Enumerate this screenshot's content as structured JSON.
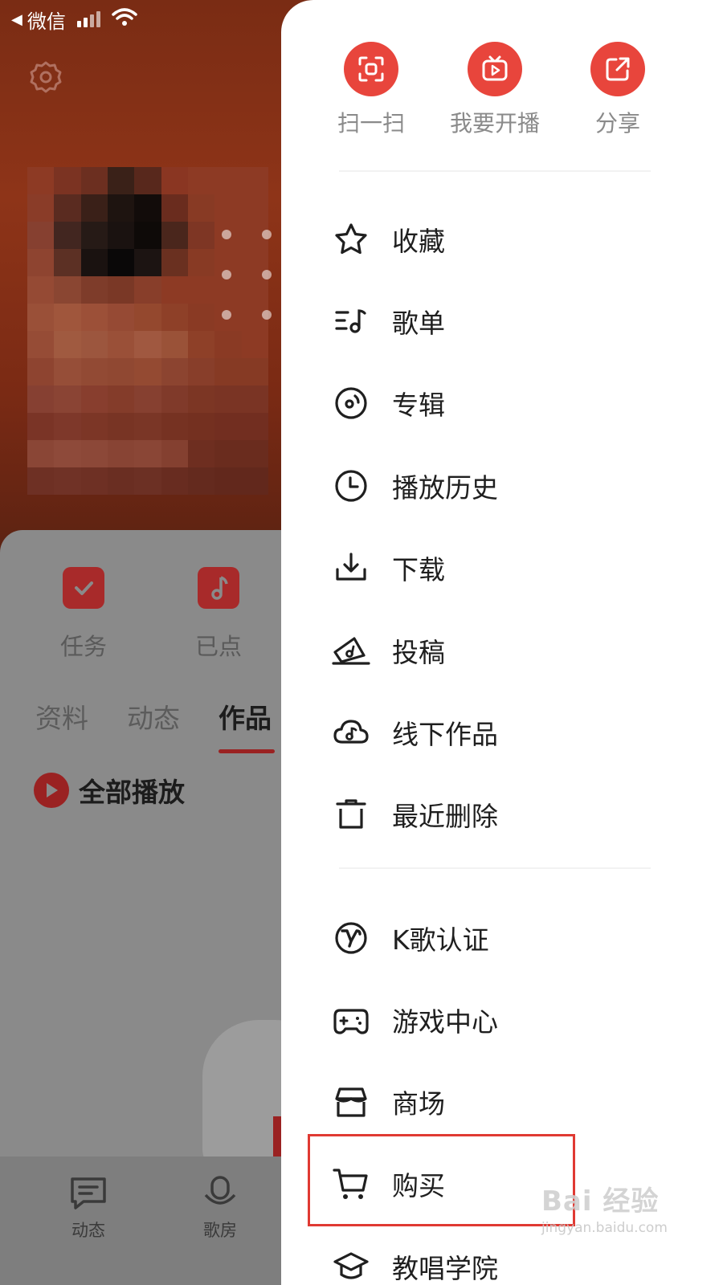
{
  "status_bar": {
    "back_label": "微信"
  },
  "quick_items": [
    {
      "label": "任务",
      "icon": "calendar-check-icon"
    },
    {
      "label": "已点",
      "icon": "music-note-icon"
    }
  ],
  "profile_tabs": [
    {
      "label": "资料",
      "active": false
    },
    {
      "label": "动态",
      "active": false
    },
    {
      "label": "作品",
      "active": true
    }
  ],
  "play_all_label": "全部播放",
  "bottom_nav": [
    {
      "label": "动态",
      "icon": "message-icon"
    },
    {
      "label": "歌房",
      "icon": "microphone-icon"
    }
  ],
  "drawer": {
    "top_actions": [
      {
        "label": "扫一扫",
        "icon": "scan-icon"
      },
      {
        "label": "我要开播",
        "icon": "live-tv-icon"
      },
      {
        "label": "分享",
        "icon": "share-icon"
      }
    ],
    "menu_group_1": [
      {
        "label": "收藏",
        "icon": "star-icon"
      },
      {
        "label": "歌单",
        "icon": "playlist-icon"
      },
      {
        "label": "专辑",
        "icon": "album-icon"
      },
      {
        "label": "播放历史",
        "icon": "clock-icon"
      },
      {
        "label": "下载",
        "icon": "download-icon"
      },
      {
        "label": "投稿",
        "icon": "submit-icon"
      },
      {
        "label": "线下作品",
        "icon": "cloud-music-icon"
      },
      {
        "label": "最近删除",
        "icon": "trash-icon"
      }
    ],
    "menu_group_2": [
      {
        "label": "K歌认证",
        "icon": "verified-v-icon"
      },
      {
        "label": "游戏中心",
        "icon": "gamepad-icon"
      },
      {
        "label": "商场",
        "icon": "store-icon"
      },
      {
        "label": "购买",
        "icon": "cart-icon"
      },
      {
        "label": "教唱学院",
        "icon": "graduation-icon"
      }
    ]
  },
  "watermark": {
    "main": "Bai 经验",
    "sub": "jingyan.baidu.com"
  },
  "colors": {
    "accent": "#e8453c",
    "highlight": "#e03a33",
    "text": "#1f1f1f"
  }
}
